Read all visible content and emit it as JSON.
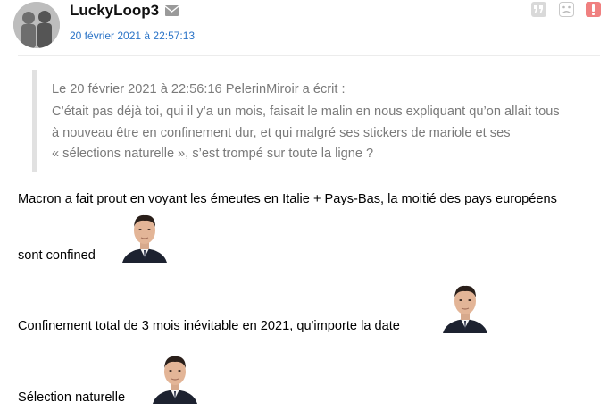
{
  "post": {
    "username": "LuckyLoop3",
    "date": "20 février 2021 à 22:57:13",
    "header_icons": [
      "quote-icon",
      "sad-face-icon",
      "alert-icon"
    ]
  },
  "quote": {
    "lines": [
      "Le 20 février 2021 à 22:56:16 PelerinMiroir a écrit :",
      "C’était pas déjà toi, qui il y’a un mois, faisait le malin en nous expliquant qu’on allait tous",
      "à nouveau être en confinement dur, et qui malgré ses stickers de mariole et ses",
      "« sélections naturelle », s’est trompé sur toute la ligne ?"
    ]
  },
  "message": {
    "line1": "Macron a fait prout en voyant les émeutes en Italie + Pays-Bas, la moitié des pays européens",
    "line2": "sont confined",
    "line3": "Confinement total de 3 mois inévitable en 2021, qu'importe la date",
    "line4": "Sélection naturelle"
  },
  "colors": {
    "date_link": "#2b74c7",
    "quote_text": "#7a7a7a",
    "alert": "#f08080"
  }
}
